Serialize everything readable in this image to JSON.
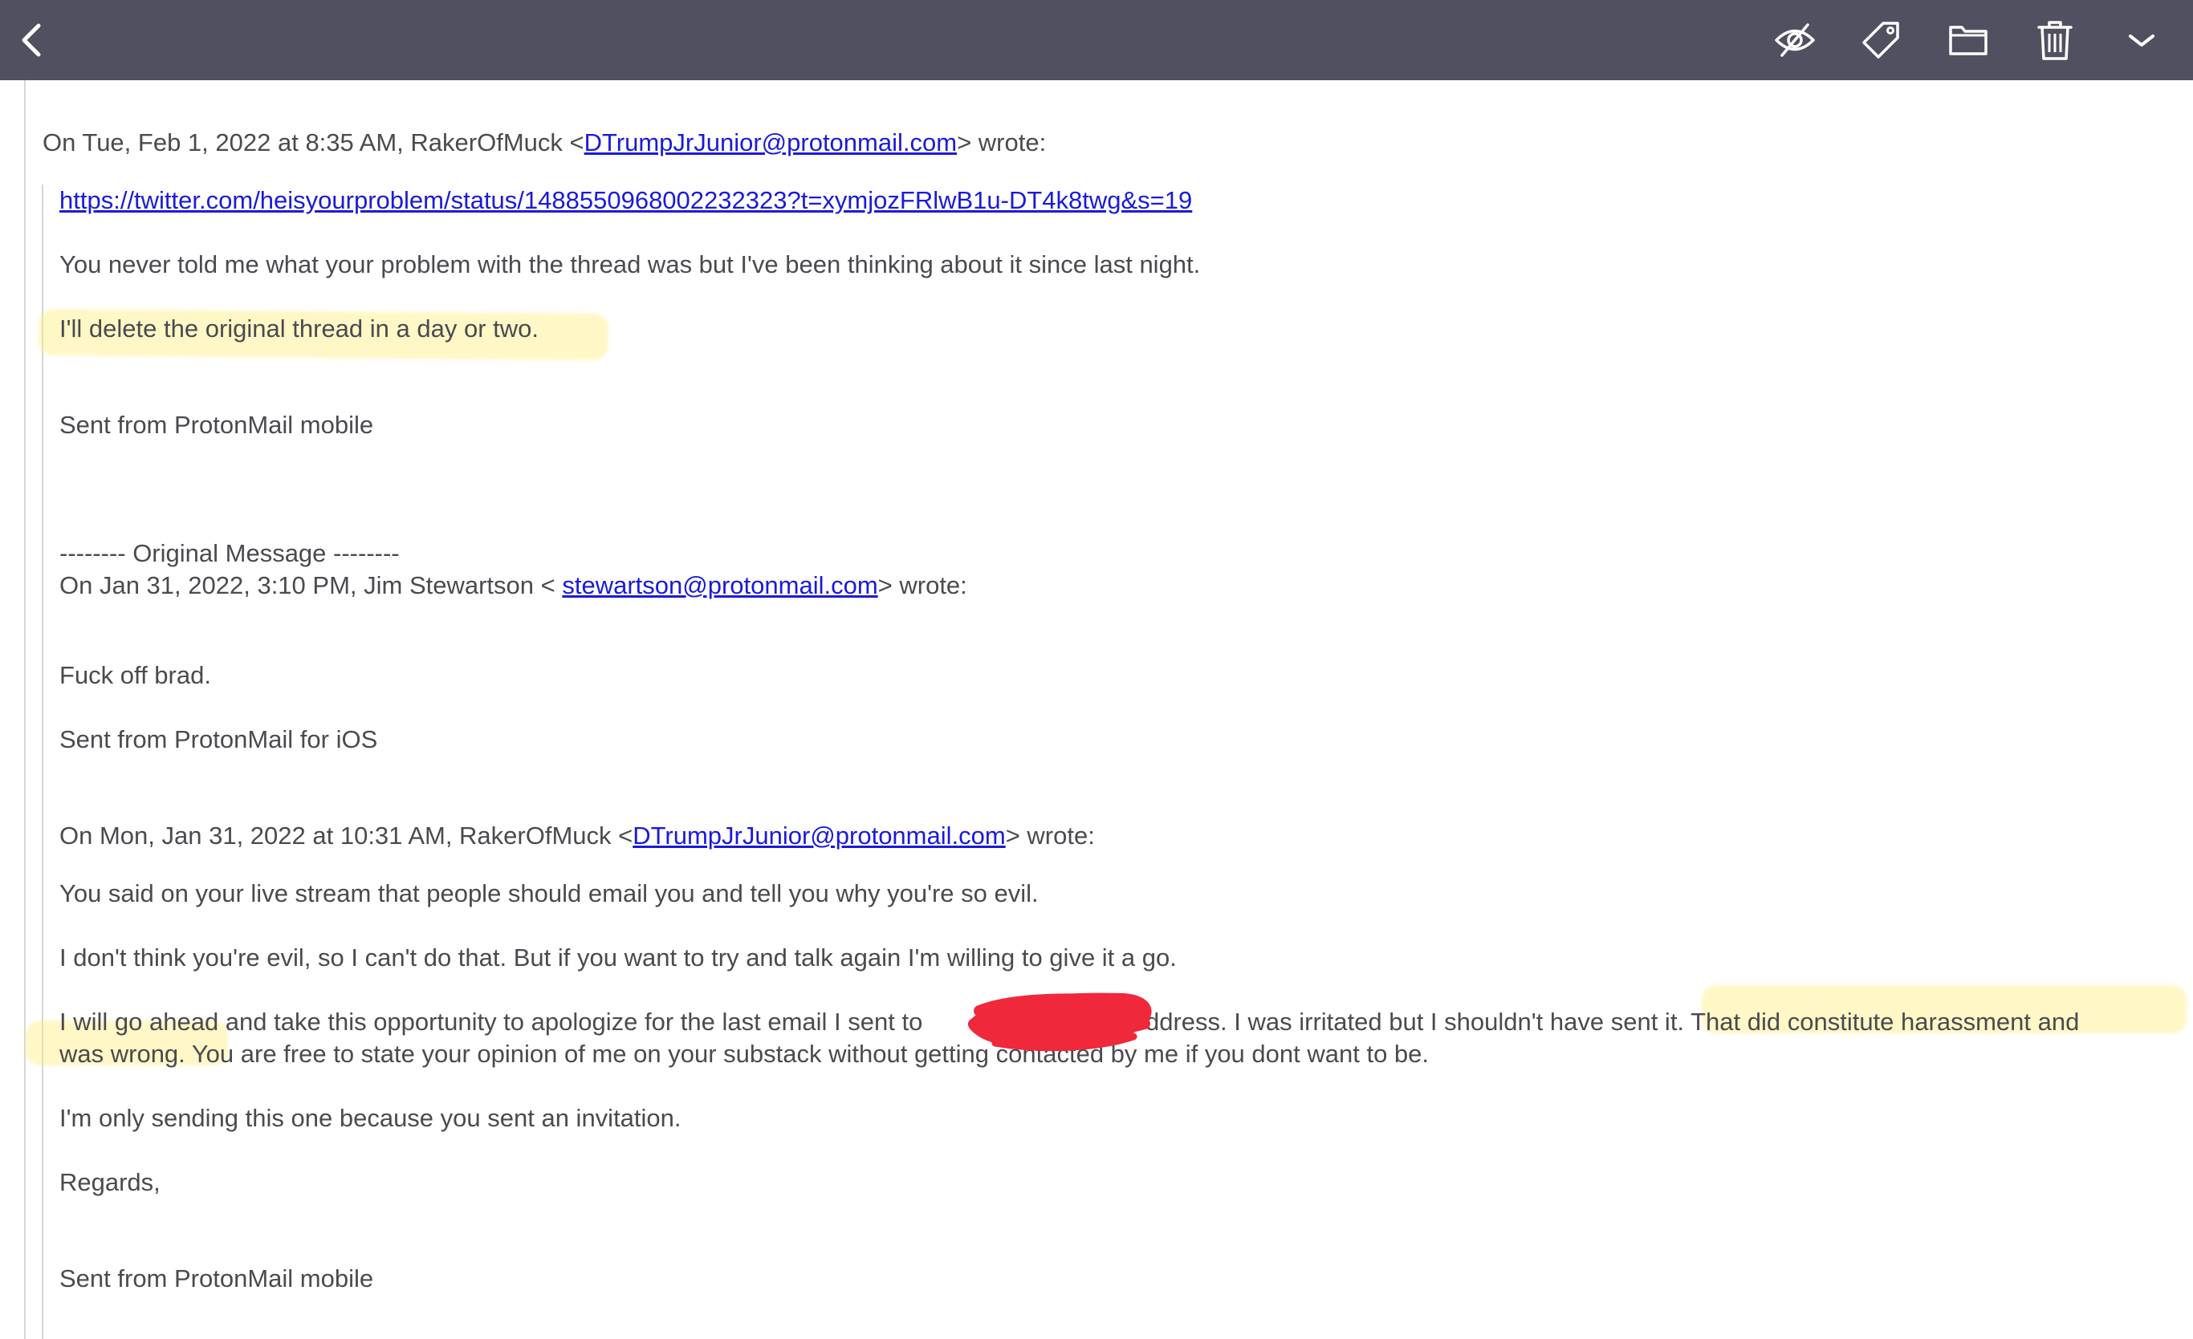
{
  "toolbar": {
    "background": "#505061",
    "icons": {
      "back": "chevron-left-icon",
      "unread": "eye-slash-icon",
      "label": "tag-icon",
      "move": "folder-icon",
      "trash": "trash-icon",
      "more": "chevron-down-icon"
    }
  },
  "colors": {
    "text": "#4a4a4f",
    "link": "#1a1adb",
    "highlight": "#ffec78",
    "redaction": "#f0283c"
  },
  "email": {
    "header1": {
      "prefix": "On Tue, Feb 1, 2022 at 8:35 AM, RakerOfMuck <",
      "email": "DTrumpJrJunior@protonmail.com",
      "suffix": "> wrote:"
    },
    "twitter_link": "https://twitter.com/heisyourproblem/status/1488550968002232323?t=xymjozFRlwB1u-DT4k8twg&s=19",
    "para1": "You never told me what your problem with the thread was but I've been thinking about it since last night.",
    "para2": "I'll delete the original thread in a day or two.",
    "sig1": "Sent from ProtonMail mobile",
    "orig_divider": "-------- Original Message --------",
    "header2": {
      "prefix": "On Jan 31, 2022, 3:10 PM, Jim Stewartson < ",
      "email": "stewartson@protonmail.com",
      "suffix": "> wrote:"
    },
    "reply_text": "Fuck off brad.",
    "sig2": "Sent from ProtonMail for iOS",
    "header3": {
      "prefix": "On Mon, Jan 31, 2022 at 10:31 AM, RakerOfMuck <",
      "email": "DTrumpJrJunior@protonmail.com",
      "suffix": "> wrote:"
    },
    "para3": "You said on your live stream that people should email you and tell you why you're so evil.",
    "para4": "I don't think you're evil, so I can't do that. But if you want to try and talk again I'm willing to give it a go.",
    "para5_line1": "I will go ahead and take this opportunity to apologize for the last email I sent to",
    "para5_line1_after": "ddress. I was irritated but I shouldn't have sent it. That did constitute harassment and",
    "para5_line2": "was wrong. You are free to state your opinion of me on your substack without getting contacted by me if you dont want to be.",
    "para6": "I'm only sending this one because you sent an invitation.",
    "closing": "Regards,",
    "sig3": "Sent from ProtonMail mobile"
  }
}
